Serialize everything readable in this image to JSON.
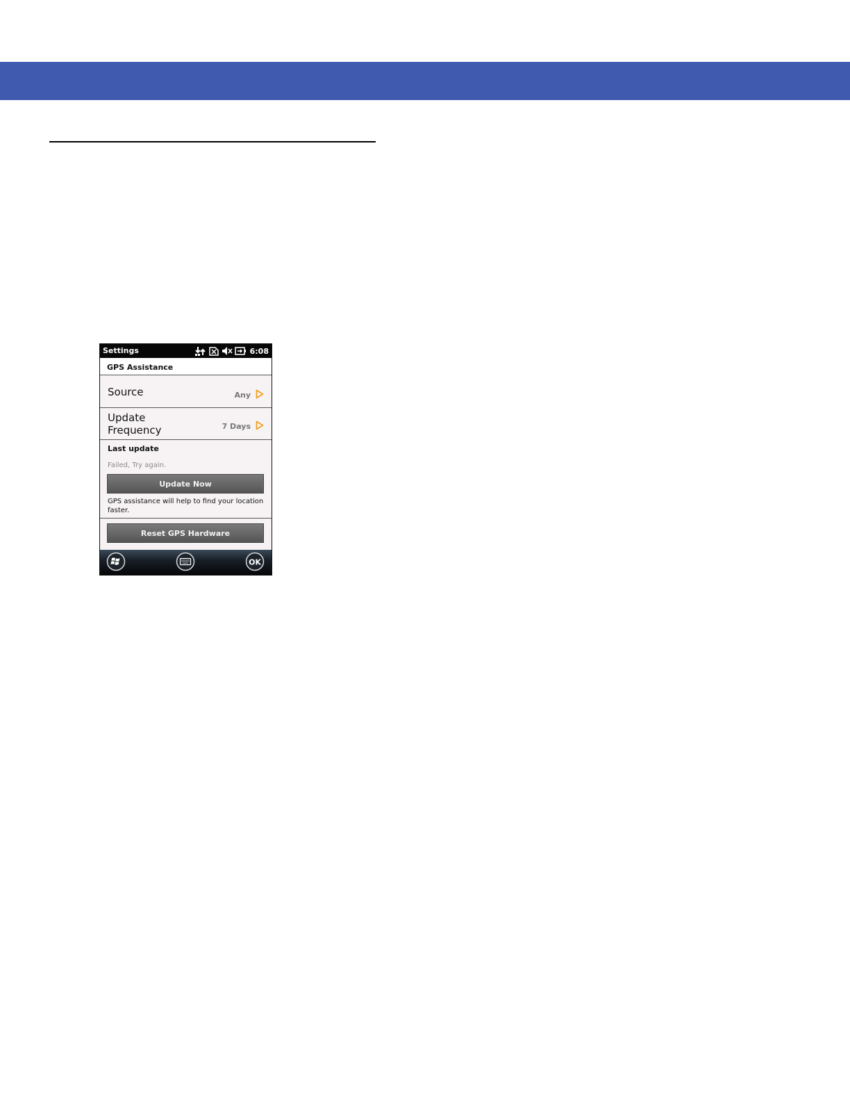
{
  "device": {
    "statusbar": {
      "title": "Settings",
      "icons": [
        "connectivity-icon",
        "no-sim-icon",
        "speaker-muted-icon",
        "battery-charging-icon"
      ],
      "time": "6:08"
    },
    "page_title": "GPS Assistance",
    "settings": {
      "source": {
        "label": "Source",
        "value": "Any"
      },
      "update_frequency": {
        "label_line1": "Update",
        "label_line2": "Frequency",
        "value": "7 Days"
      }
    },
    "last_update": {
      "heading": "Last update",
      "status": "Failed, Try again.",
      "update_button": "Update Now",
      "description": "GPS assistance will help to find your location faster."
    },
    "reset_button": "Reset GPS Hardware",
    "softkeys": {
      "ok_label": "OK",
      "icons": [
        "windows-start-icon",
        "keyboard-icon"
      ]
    }
  },
  "colors": {
    "header_band": "#3f5aaf",
    "arrow_accent": "#f0a020",
    "button_gray": "#606060"
  }
}
